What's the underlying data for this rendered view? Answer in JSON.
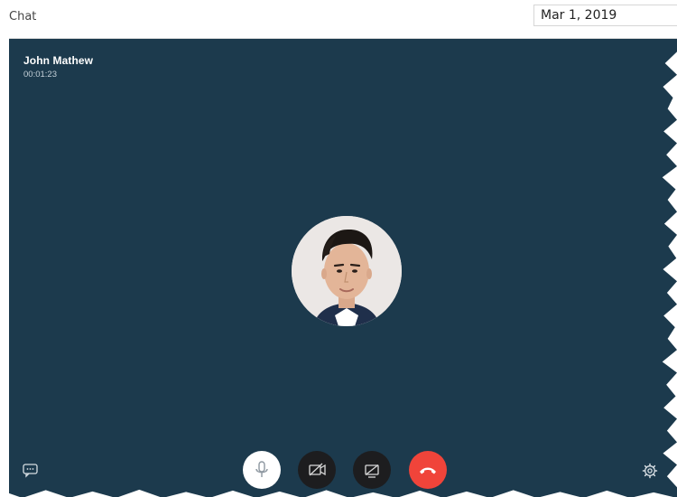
{
  "header": {
    "title": "Chat",
    "date_value": "Mar 1, 2019"
  },
  "call": {
    "caller_name": "John Mathew",
    "duration": "00:01:23"
  },
  "controls": {
    "mic_icon": "microphone-icon",
    "video_icon": "video-off-icon",
    "screen_icon": "screen-share-off-icon",
    "end_icon": "end-call-icon",
    "chat_icon": "chat-icon",
    "settings_icon": "gear-icon"
  },
  "colors": {
    "call_background": "#1c3a4d",
    "end_call": "#f0443a",
    "control_dark": "#1d1d1f",
    "mic_button": "#ffffff"
  }
}
